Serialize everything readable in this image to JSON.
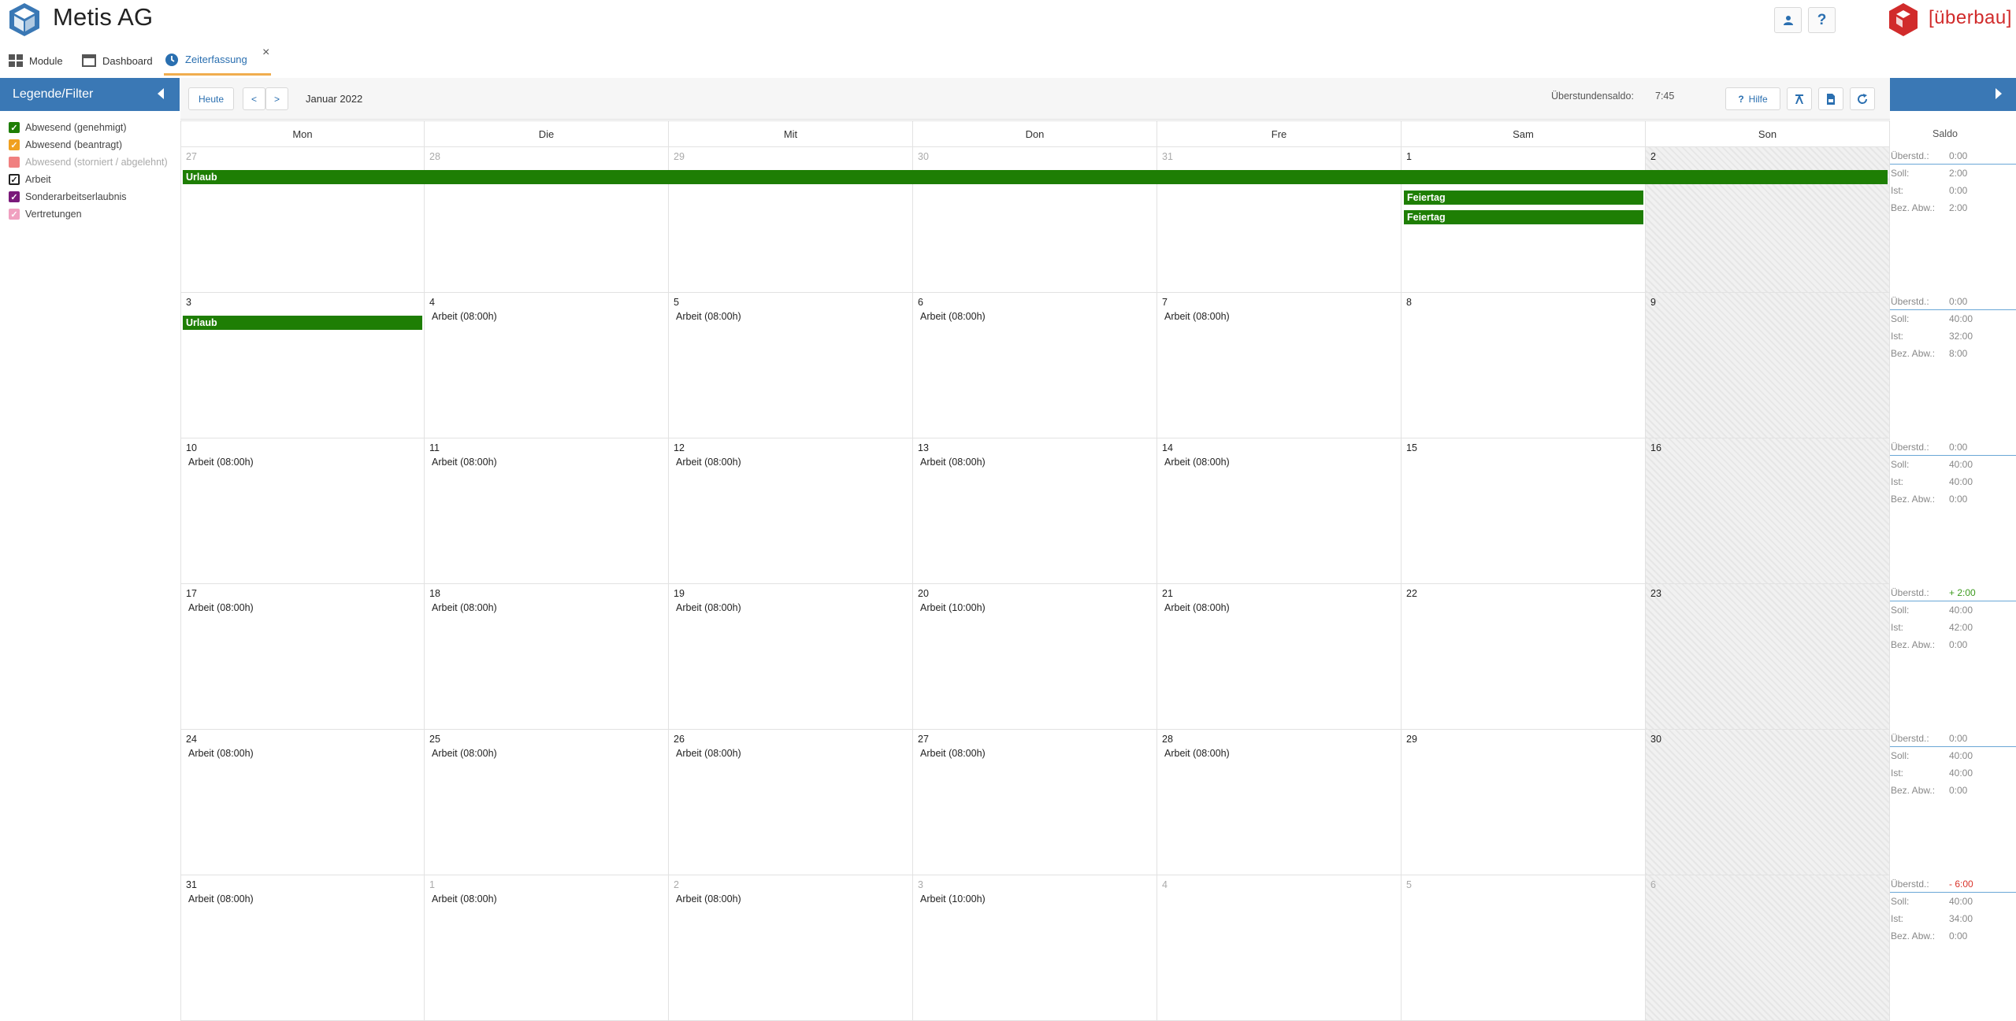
{
  "app": {
    "title": "Metis AG",
    "brand": "[überbau]"
  },
  "header": {
    "user_icon": "user-icon",
    "help_label": "?"
  },
  "tabs": [
    {
      "label": "Module",
      "icon": "grid-icon"
    },
    {
      "label": "Dashboard",
      "icon": "window-icon"
    },
    {
      "label": "Zeiterfassung",
      "icon": "clock-icon",
      "active": true,
      "close": "×"
    }
  ],
  "sidebar": {
    "title": "Legende/Filter",
    "legend": [
      {
        "label": "Abwesend (genehmigt)",
        "color": "#1e7e04",
        "checked": true
      },
      {
        "label": "Abwesend (beantragt)",
        "color": "#f0a020",
        "checked": true
      },
      {
        "label": "Abwesend (storniert / abgelehnt)",
        "color": "#f08080",
        "checked": false
      },
      {
        "label": "Arbeit",
        "color": "#222222",
        "checked": true,
        "outline": true
      },
      {
        "label": "Sonderarbeitserlaubnis",
        "color": "#7a1a7a",
        "checked": true
      },
      {
        "label": "Vertretungen",
        "color": "#f0a0c0",
        "checked": true
      }
    ]
  },
  "toolbar": {
    "today": "Heute",
    "prev": "<",
    "next": ">",
    "month": "Januar 2022",
    "saldo_label": "Überstundensaldo:",
    "saldo_value": "7:45",
    "help": "Hilfe"
  },
  "calendar": {
    "day_headers": [
      "Mon",
      "Die",
      "Mit",
      "Don",
      "Fre",
      "Sam",
      "Son"
    ],
    "saldo_header": "Saldo",
    "weeks": [
      {
        "days": [
          {
            "num": "27",
            "other": true
          },
          {
            "num": "28",
            "other": true
          },
          {
            "num": "29",
            "other": true
          },
          {
            "num": "30",
            "other": true
          },
          {
            "num": "31",
            "other": true
          },
          {
            "num": "1"
          },
          {
            "num": "2"
          }
        ]
      },
      {
        "days": [
          {
            "num": "3"
          },
          {
            "num": "4",
            "work": "Arbeit (08:00h)"
          },
          {
            "num": "5",
            "work": "Arbeit (08:00h)"
          },
          {
            "num": "6",
            "work": "Arbeit (08:00h)"
          },
          {
            "num": "7",
            "work": "Arbeit (08:00h)"
          },
          {
            "num": "8"
          },
          {
            "num": "9"
          }
        ]
      },
      {
        "days": [
          {
            "num": "10",
            "work": "Arbeit (08:00h)"
          },
          {
            "num": "11",
            "work": "Arbeit (08:00h)"
          },
          {
            "num": "12",
            "work": "Arbeit (08:00h)"
          },
          {
            "num": "13",
            "work": "Arbeit (08:00h)"
          },
          {
            "num": "14",
            "work": "Arbeit (08:00h)"
          },
          {
            "num": "15"
          },
          {
            "num": "16"
          }
        ]
      },
      {
        "days": [
          {
            "num": "17",
            "work": "Arbeit (08:00h)"
          },
          {
            "num": "18",
            "work": "Arbeit (08:00h)"
          },
          {
            "num": "19",
            "work": "Arbeit (08:00h)"
          },
          {
            "num": "20",
            "work": "Arbeit (10:00h)"
          },
          {
            "num": "21",
            "work": "Arbeit (08:00h)"
          },
          {
            "num": "22"
          },
          {
            "num": "23"
          }
        ]
      },
      {
        "days": [
          {
            "num": "24",
            "work": "Arbeit (08:00h)"
          },
          {
            "num": "25",
            "work": "Arbeit (08:00h)"
          },
          {
            "num": "26",
            "work": "Arbeit (08:00h)"
          },
          {
            "num": "27",
            "work": "Arbeit (08:00h)"
          },
          {
            "num": "28",
            "work": "Arbeit (08:00h)"
          },
          {
            "num": "29"
          },
          {
            "num": "30"
          }
        ]
      },
      {
        "days": [
          {
            "num": "31",
            "work": "Arbeit (08:00h)"
          },
          {
            "num": "1",
            "other": true,
            "work": "Arbeit (08:00h)"
          },
          {
            "num": "2",
            "other": true,
            "work": "Arbeit (08:00h)"
          },
          {
            "num": "3",
            "other": true,
            "work": "Arbeit (10:00h)"
          },
          {
            "num": "4",
            "other": true
          },
          {
            "num": "5",
            "other": true
          },
          {
            "num": "6",
            "other": true
          }
        ]
      }
    ],
    "events": {
      "urlaub_week1": "Urlaub",
      "feiertag_1": "Feiertag",
      "feiertag_2": "Feiertag",
      "urlaub_week2": "Urlaub"
    },
    "saldo": [
      {
        "ueber": "0:00",
        "soll": "2:00",
        "ist": "0:00",
        "bez": "2:00",
        "sign": ""
      },
      {
        "ueber": "0:00",
        "soll": "40:00",
        "ist": "32:00",
        "bez": "8:00",
        "sign": ""
      },
      {
        "ueber": "0:00",
        "soll": "40:00",
        "ist": "40:00",
        "bez": "0:00",
        "sign": ""
      },
      {
        "ueber": "+ 2:00",
        "soll": "40:00",
        "ist": "42:00",
        "bez": "0:00",
        "sign": "pos"
      },
      {
        "ueber": "0:00",
        "soll": "40:00",
        "ist": "40:00",
        "bez": "0:00",
        "sign": ""
      },
      {
        "ueber": "- 6:00",
        "soll": "40:00",
        "ist": "34:00",
        "bez": "0:00",
        "sign": "neg"
      }
    ],
    "saldo_labels": {
      "ueber": "Überstd.:",
      "soll": "Soll:",
      "ist": "Ist:",
      "bez": "Bez. Abw.:"
    }
  }
}
